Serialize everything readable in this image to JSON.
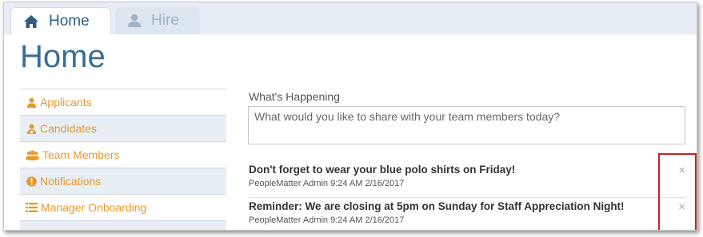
{
  "tabs": [
    {
      "label": "Home",
      "icon": "home-icon",
      "active": true
    },
    {
      "label": "Hire",
      "icon": "user-icon",
      "active": false
    }
  ],
  "page": {
    "title": "Home"
  },
  "sidebar": {
    "accent": "#e69a2e",
    "items": [
      {
        "label": "Applicants",
        "icon": "user-icon"
      },
      {
        "label": "Candidates",
        "icon": "user-badge-icon"
      },
      {
        "label": "Team Members",
        "icon": "users-icon"
      },
      {
        "label": "Notifications",
        "icon": "exclamation-circle-icon"
      },
      {
        "label": "Manager Onboarding",
        "icon": "list-icon"
      }
    ]
  },
  "main": {
    "section_label": "What's Happening",
    "share": {
      "placeholder": "What would you like to share with your team members today?",
      "value": ""
    },
    "posts": [
      {
        "text": "Don't forget to wear your blue polo shirts on Friday!",
        "author": "PeopleMatter Admin",
        "timestamp": "9:24 AM 2/16/2017",
        "dismiss_glyph": "×"
      },
      {
        "text": "Reminder: We are closing at 5pm on Sunday for Staff Appreciation Night!",
        "author": "PeopleMatter Admin",
        "timestamp": "9:24 AM 2/16/2017",
        "dismiss_glyph": "×"
      }
    ]
  }
}
